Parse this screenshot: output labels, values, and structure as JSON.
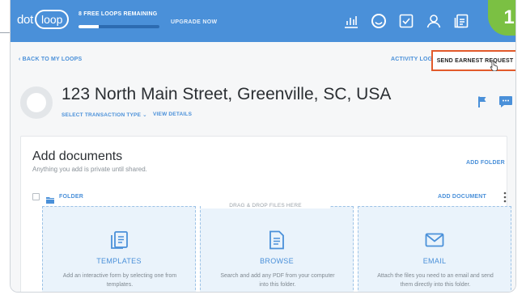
{
  "header": {
    "logo_dot": "dot",
    "logo_loop": "loop",
    "free_loops": "8 FREE LOOPS REMAINING",
    "free_loops_progress": 0.25,
    "upgrade": "UPGRADE NOW",
    "nav_icons": [
      "reports-icon",
      "loops-icon",
      "tasks-icon",
      "profile-icon",
      "templates-icon"
    ]
  },
  "step_badge": "1",
  "links": {
    "back": "‹ BACK TO MY LOOPS",
    "activity_log": "ACTIVITY LOG",
    "send_earnest": "SEND EARNEST REQUEST"
  },
  "loop": {
    "address": "123 North Main Street, Greenville, SC, USA",
    "select_type": "SELECT TRANSACTION TYPE ⌄",
    "view_details": "VIEW DETAILS"
  },
  "documents": {
    "title": "Add documents",
    "subtitle": "Anything you add is private until shared.",
    "add_folder": "ADD FOLDER",
    "folder_label": "FOLDER",
    "add_document": "ADD DOCUMENT",
    "drop_hint": "DRAG & DROP FILES HERE",
    "tiles": [
      {
        "title": "TEMPLATES",
        "desc": "Add an interactive form by selecting one from templates."
      },
      {
        "title": "BROWSE",
        "desc": "Search and add any PDF from your computer into this folder."
      },
      {
        "title": "EMAIL",
        "desc": "Attach the files you need to an email and send them directly into this folder."
      }
    ]
  },
  "colors": {
    "brand_blue": "#4a90d9",
    "highlight": "#e25a2b",
    "badge_green": "#7bc043"
  }
}
